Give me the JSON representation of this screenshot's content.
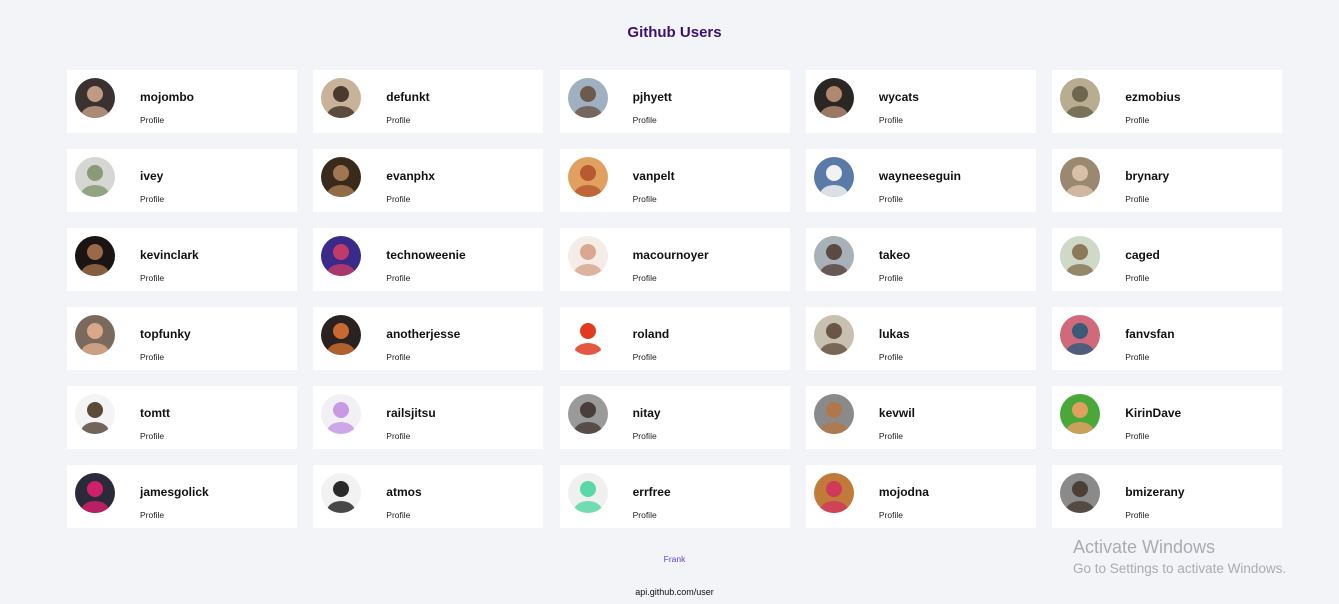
{
  "page": {
    "title": "Github Users",
    "profile_label": "Profile",
    "footer_author": "Frank",
    "footer_api": "api.github.com/user"
  },
  "watermark": {
    "title": "Activate Windows",
    "subtitle": "Go to Settings to activate Windows."
  },
  "users": [
    {
      "login": "mojombo",
      "avatar_colors": [
        "#3a3230",
        "#c09a82"
      ]
    },
    {
      "login": "defunkt",
      "avatar_colors": [
        "#c8b39a",
        "#4a3a2e"
      ]
    },
    {
      "login": "pjhyett",
      "avatar_colors": [
        "#9fb0c0",
        "#6e5a4c"
      ]
    },
    {
      "login": "wycats",
      "avatar_colors": [
        "#2a2624",
        "#b08870"
      ]
    },
    {
      "login": "ezmobius",
      "avatar_colors": [
        "#b8ad90",
        "#6f6650"
      ]
    },
    {
      "login": "ivey",
      "avatar_colors": [
        "#d6d6d2",
        "#8a9a78"
      ]
    },
    {
      "login": "evanphx",
      "avatar_colors": [
        "#3a2a1c",
        "#a07850"
      ]
    },
    {
      "login": "vanpelt",
      "avatar_colors": [
        "#e0a060",
        "#b85a30"
      ]
    },
    {
      "login": "wayneeseguin",
      "avatar_colors": [
        "#5a7aa8",
        "#f2f2f2"
      ]
    },
    {
      "login": "brynary",
      "avatar_colors": [
        "#9a8870",
        "#d8c0a8"
      ]
    },
    {
      "login": "kevinclark",
      "avatar_colors": [
        "#1a1412",
        "#9a6a48"
      ]
    },
    {
      "login": "technoweenie",
      "avatar_colors": [
        "#3a2a8a",
        "#c03a6a"
      ]
    },
    {
      "login": "macournoyer",
      "avatar_colors": [
        "#f4ece6",
        "#d8a890"
      ]
    },
    {
      "login": "takeo",
      "avatar_colors": [
        "#a8b0b8",
        "#5a4a42"
      ]
    },
    {
      "login": "caged",
      "avatar_colors": [
        "#d0d8c8",
        "#8a7a5a"
      ]
    },
    {
      "login": "topfunky",
      "avatar_colors": [
        "#7a6a5e",
        "#d8a888"
      ]
    },
    {
      "login": "anotherjesse",
      "avatar_colors": [
        "#2a2220",
        "#c86a30"
      ]
    },
    {
      "login": "roland",
      "avatar_colors": [
        "#ffffff",
        "#e03a20"
      ]
    },
    {
      "login": "lukas",
      "avatar_colors": [
        "#c8c0b0",
        "#6a5646"
      ]
    },
    {
      "login": "fanvsfan",
      "avatar_colors": [
        "#d06a7a",
        "#3a5a7a"
      ]
    },
    {
      "login": "tomtt",
      "avatar_colors": [
        "#f4f4f4",
        "#5a4a3a"
      ]
    },
    {
      "login": "railsjitsu",
      "avatar_colors": [
        "#f2f0f4",
        "#c89ae6"
      ]
    },
    {
      "login": "nitay",
      "avatar_colors": [
        "#9a9a9a",
        "#4a3e3a"
      ]
    },
    {
      "login": "kevwil",
      "avatar_colors": [
        "#8a8a8a",
        "#b0784a"
      ]
    },
    {
      "login": "KirinDave",
      "avatar_colors": [
        "#4aa83a",
        "#e0a060"
      ]
    },
    {
      "login": "jamesgolick",
      "avatar_colors": [
        "#2a2a3a",
        "#d0206a"
      ]
    },
    {
      "login": "atmos",
      "avatar_colors": [
        "#f2f2f2",
        "#2a2a2a"
      ]
    },
    {
      "login": "errfree",
      "avatar_colors": [
        "#f0f0f0",
        "#5ad8a6"
      ]
    },
    {
      "login": "mojodna",
      "avatar_colors": [
        "#c07a3a",
        "#d03a5a"
      ]
    },
    {
      "login": "bmizerany",
      "avatar_colors": [
        "#8a8a8a",
        "#4a4038"
      ]
    }
  ]
}
